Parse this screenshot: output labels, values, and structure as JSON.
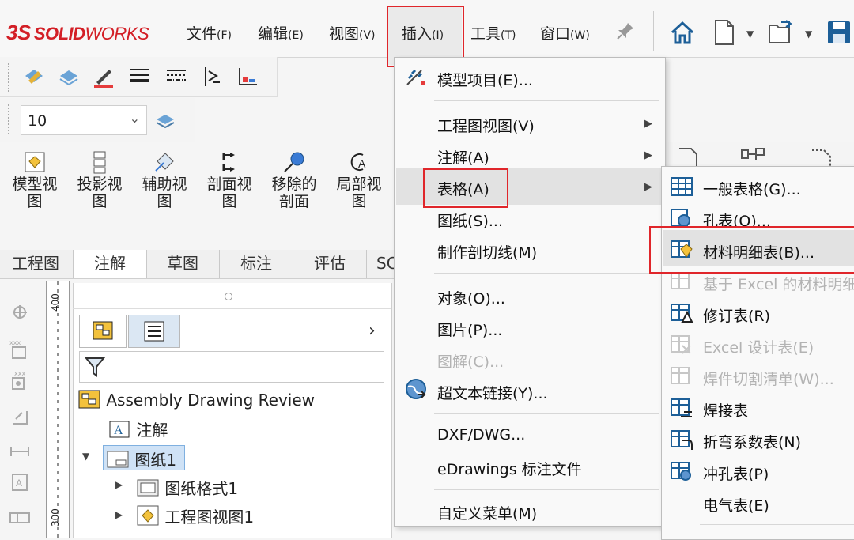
{
  "app": {
    "logo_ds": "3S",
    "logo_brand": "SOLID",
    "logo_brand2": "WORKS"
  },
  "menubar": {
    "items": [
      {
        "label": "文件",
        "key": "(F)"
      },
      {
        "label": "编辑",
        "key": "(E)"
      },
      {
        "label": "视图",
        "key": "(V)"
      },
      {
        "label": "插入",
        "key": "(I)"
      },
      {
        "label": "工具",
        "key": "(T)"
      },
      {
        "label": "窗口",
        "key": "(W)"
      }
    ]
  },
  "toolbar": {
    "scale_value": "10"
  },
  "big_buttons": [
    {
      "line1": "模型视",
      "line2": "图"
    },
    {
      "line1": "投影视",
      "line2": "图"
    },
    {
      "line1": "辅助视",
      "line2": "图"
    },
    {
      "line1": "剖面视",
      "line2": "图"
    },
    {
      "line1": "移除的",
      "line2": "剖面"
    },
    {
      "line1": "局部视",
      "line2": "图"
    }
  ],
  "tabs": [
    "工程图",
    "注解",
    "草图",
    "标注",
    "评估",
    "SC"
  ],
  "ruler": {
    "label_top": "400",
    "label_bottom": "300"
  },
  "tree": {
    "root": "Assembly Drawing Review",
    "annotations": "注解",
    "sheet": "图纸1",
    "sheet_format": "图纸格式1",
    "drawing_view": "工程图视图1"
  },
  "insert_menu": {
    "model_items": "模型项目(E)...",
    "drawing_view": "工程图视图(V)",
    "annotation": "注解(A)",
    "table": "表格(A)",
    "sheet": "图纸(S)...",
    "cutting_line": "制作剖切线(M)",
    "object": "对象(O)...",
    "picture": "图片(P)...",
    "illustration": "图解(C)...",
    "hyperlink": "超文本链接(Y)...",
    "dxf": "DXF/DWG...",
    "edrawings": "eDrawings 标注文件",
    "customize": "自定义菜单(M)"
  },
  "table_submenu": {
    "general": "一般表格(G)...",
    "hole": "孔表(O)...",
    "bom": "材料明细表(B)...",
    "excel_bom": "基于 Excel 的材料明细",
    "revision": "修订表(R)",
    "excel_design": "Excel 设计表(E)",
    "weldment": "焊件切割清单(W)...",
    "weld": "焊接表",
    "bend": "折弯系数表(N)",
    "punch": "冲孔表(P)",
    "electrical": "电气表(E)"
  },
  "colors": {
    "highlight_red": "#e0262b",
    "brand_red": "#d31f26"
  }
}
